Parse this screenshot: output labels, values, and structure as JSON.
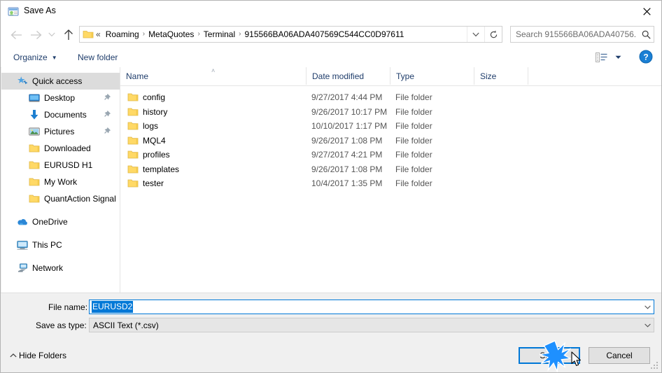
{
  "window": {
    "title": "Save As",
    "icon": "save-as-app-icon",
    "close_label": "✕"
  },
  "nav": {
    "back_icon": "arrow-left-icon",
    "forward_icon": "arrow-right-icon",
    "recent_icon": "chevron-down-icon",
    "up_icon": "arrow-up-icon",
    "address": {
      "folder_icon": "folder-icon",
      "overflow": "«",
      "separator": "›",
      "crumbs": [
        "Roaming",
        "MetaQuotes",
        "Terminal",
        "915566BA06ADA407569C544CC0D97611"
      ],
      "dropdown_icon": "chevron-down-icon",
      "refresh_icon": "refresh-icon"
    },
    "search": {
      "placeholder": "Search 915566BA06ADA40756...",
      "value": "",
      "icon": "search-icon"
    }
  },
  "toolbar": {
    "organize_label": "Organize",
    "organize_caret": "▼",
    "new_folder_label": "New folder",
    "view_icon": "view-layout-icon",
    "view_caret": "▼",
    "help_icon": "help-icon",
    "help_label": "?"
  },
  "sidebar": {
    "items": [
      {
        "label": "Quick access",
        "icon": "star-pin-icon",
        "level": 0,
        "selected": true,
        "pinned": false
      },
      {
        "label": "Desktop",
        "icon": "desktop-icon",
        "level": 1,
        "selected": false,
        "pinned": true
      },
      {
        "label": "Documents",
        "icon": "documents-download-icon",
        "level": 1,
        "selected": false,
        "pinned": true
      },
      {
        "label": "Pictures",
        "icon": "pictures-icon",
        "level": 1,
        "selected": false,
        "pinned": true
      },
      {
        "label": "Downloaded",
        "icon": "folder-icon",
        "level": 1,
        "selected": false,
        "pinned": false
      },
      {
        "label": "EURUSD H1",
        "icon": "folder-icon",
        "level": 1,
        "selected": false,
        "pinned": false
      },
      {
        "label": "My Work",
        "icon": "folder-icon",
        "level": 1,
        "selected": false,
        "pinned": false
      },
      {
        "label": "QuantAction Signal",
        "icon": "folder-icon",
        "level": 1,
        "selected": false,
        "pinned": false
      },
      {
        "label": "OneDrive",
        "icon": "onedrive-cloud-icon",
        "level": 0,
        "selected": false,
        "pinned": false,
        "gap_before": true
      },
      {
        "label": "This PC",
        "icon": "this-pc-icon",
        "level": 0,
        "selected": false,
        "pinned": false,
        "gap_before": true
      },
      {
        "label": "Network",
        "icon": "network-icon",
        "level": 0,
        "selected": false,
        "pinned": false,
        "gap_before": true
      }
    ]
  },
  "filelist": {
    "columns": [
      {
        "label": "Name",
        "sorted": "asc",
        "sort_caret": "˄"
      },
      {
        "label": "Date modified",
        "sorted": ""
      },
      {
        "label": "Type",
        "sorted": ""
      },
      {
        "label": "Size",
        "sorted": ""
      }
    ],
    "rows": [
      {
        "name": "config",
        "date": "9/27/2017 4:44 PM",
        "type": "File folder",
        "size": "",
        "icon": "folder-icon"
      },
      {
        "name": "history",
        "date": "9/26/2017 10:17 PM",
        "type": "File folder",
        "size": "",
        "icon": "folder-icon"
      },
      {
        "name": "logs",
        "date": "10/10/2017 1:17 PM",
        "type": "File folder",
        "size": "",
        "icon": "folder-icon"
      },
      {
        "name": "MQL4",
        "date": "9/26/2017 1:08 PM",
        "type": "File folder",
        "size": "",
        "icon": "folder-icon"
      },
      {
        "name": "profiles",
        "date": "9/27/2017 4:21 PM",
        "type": "File folder",
        "size": "",
        "icon": "folder-icon"
      },
      {
        "name": "templates",
        "date": "9/26/2017 1:08 PM",
        "type": "File folder",
        "size": "",
        "icon": "folder-icon"
      },
      {
        "name": "tester",
        "date": "10/4/2017 1:35 PM",
        "type": "File folder",
        "size": "",
        "icon": "folder-icon"
      }
    ]
  },
  "form": {
    "filename_label": "File name:",
    "filename_value": "EURUSD2",
    "filename_caret": "˅",
    "savetype_label": "Save as type:",
    "savetype_value": "ASCII Text (*.csv)",
    "savetype_caret": "˅"
  },
  "footer": {
    "hide_folders_label": "Hide Folders",
    "hide_folders_caret": "˄",
    "save_label": "Save",
    "cancel_label": "Cancel"
  },
  "colors": {
    "accent": "#0078d7",
    "header_text": "#1f3d6b",
    "selection": "#dcdcdc",
    "folder_yellow": "#ffd966"
  }
}
